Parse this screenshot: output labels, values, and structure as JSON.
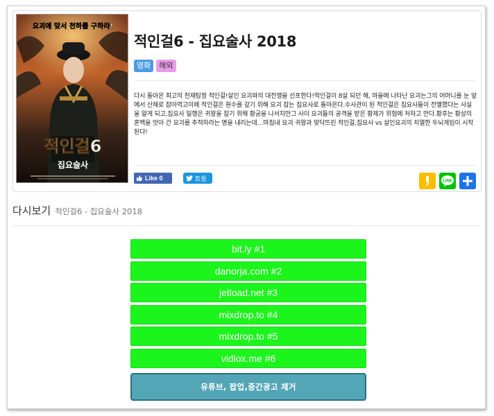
{
  "movie": {
    "title": "적인걸6 - 집요술사 2018",
    "badges": {
      "genre": "영화",
      "region": "해외"
    },
    "synopsis": "다시 돌아온 최고의 천재탐정 적인걸!살인 요괴와의 대전쟁을 선포한다!적인걸이 8살 되던 해, 마을에 나타난 요괴는그의 어머니를 눈 앞에서 산채로 잡아먹고이에 적인걸은 원수를 갚기 위해 요괴 잡는 집요사로 돌아온다.수사관이 된 적인걸은 집요사들이 전멸했다는 사실을 알게 되고,집요사 일행은 귀왕을 잡기 위해 황궁을 나서지만그 사이 요괴들의 공격을 받은 황제가 위험에 처하고 만다.황후는 황상의 혼백을 앗아 간 요괴를 추적하라는 명을 내리는데…마침내 요괴 귀왕과 맞닥뜨린 적인걸,집요사 vs 살인요괴의 치열한 두뇌게임이 시작된다!"
  },
  "poster": {
    "tagline": "요괴에 맞서 천하를 구하라!",
    "title_main": "적인걸6",
    "title_sub": "집요술사"
  },
  "social": {
    "fb_like": "Like 0",
    "tweet": "트윗",
    "icons": [
      "kakaostory-icon",
      "line-icon",
      "plus-share-icon"
    ],
    "colors": {
      "facebook": "#4267b2",
      "twitter": "#1b95e0",
      "kakao": "#f9be00",
      "line": "#00c300",
      "more": "#1f73e6"
    }
  },
  "watch": {
    "label": "다시보기",
    "subtitle": "적인걸6 - 집요술사 2018",
    "links": [
      "bit.ly #1",
      "danorja.com #2",
      "jetload.net #3",
      "mixdrop.to #4",
      "mixdrop.to #5",
      "vidlox.me #6"
    ],
    "link_color": "#1cf51c",
    "adblock_label": "유튜브, 팝업,중간광고 제거",
    "adblock_color": "#53a6b6"
  }
}
